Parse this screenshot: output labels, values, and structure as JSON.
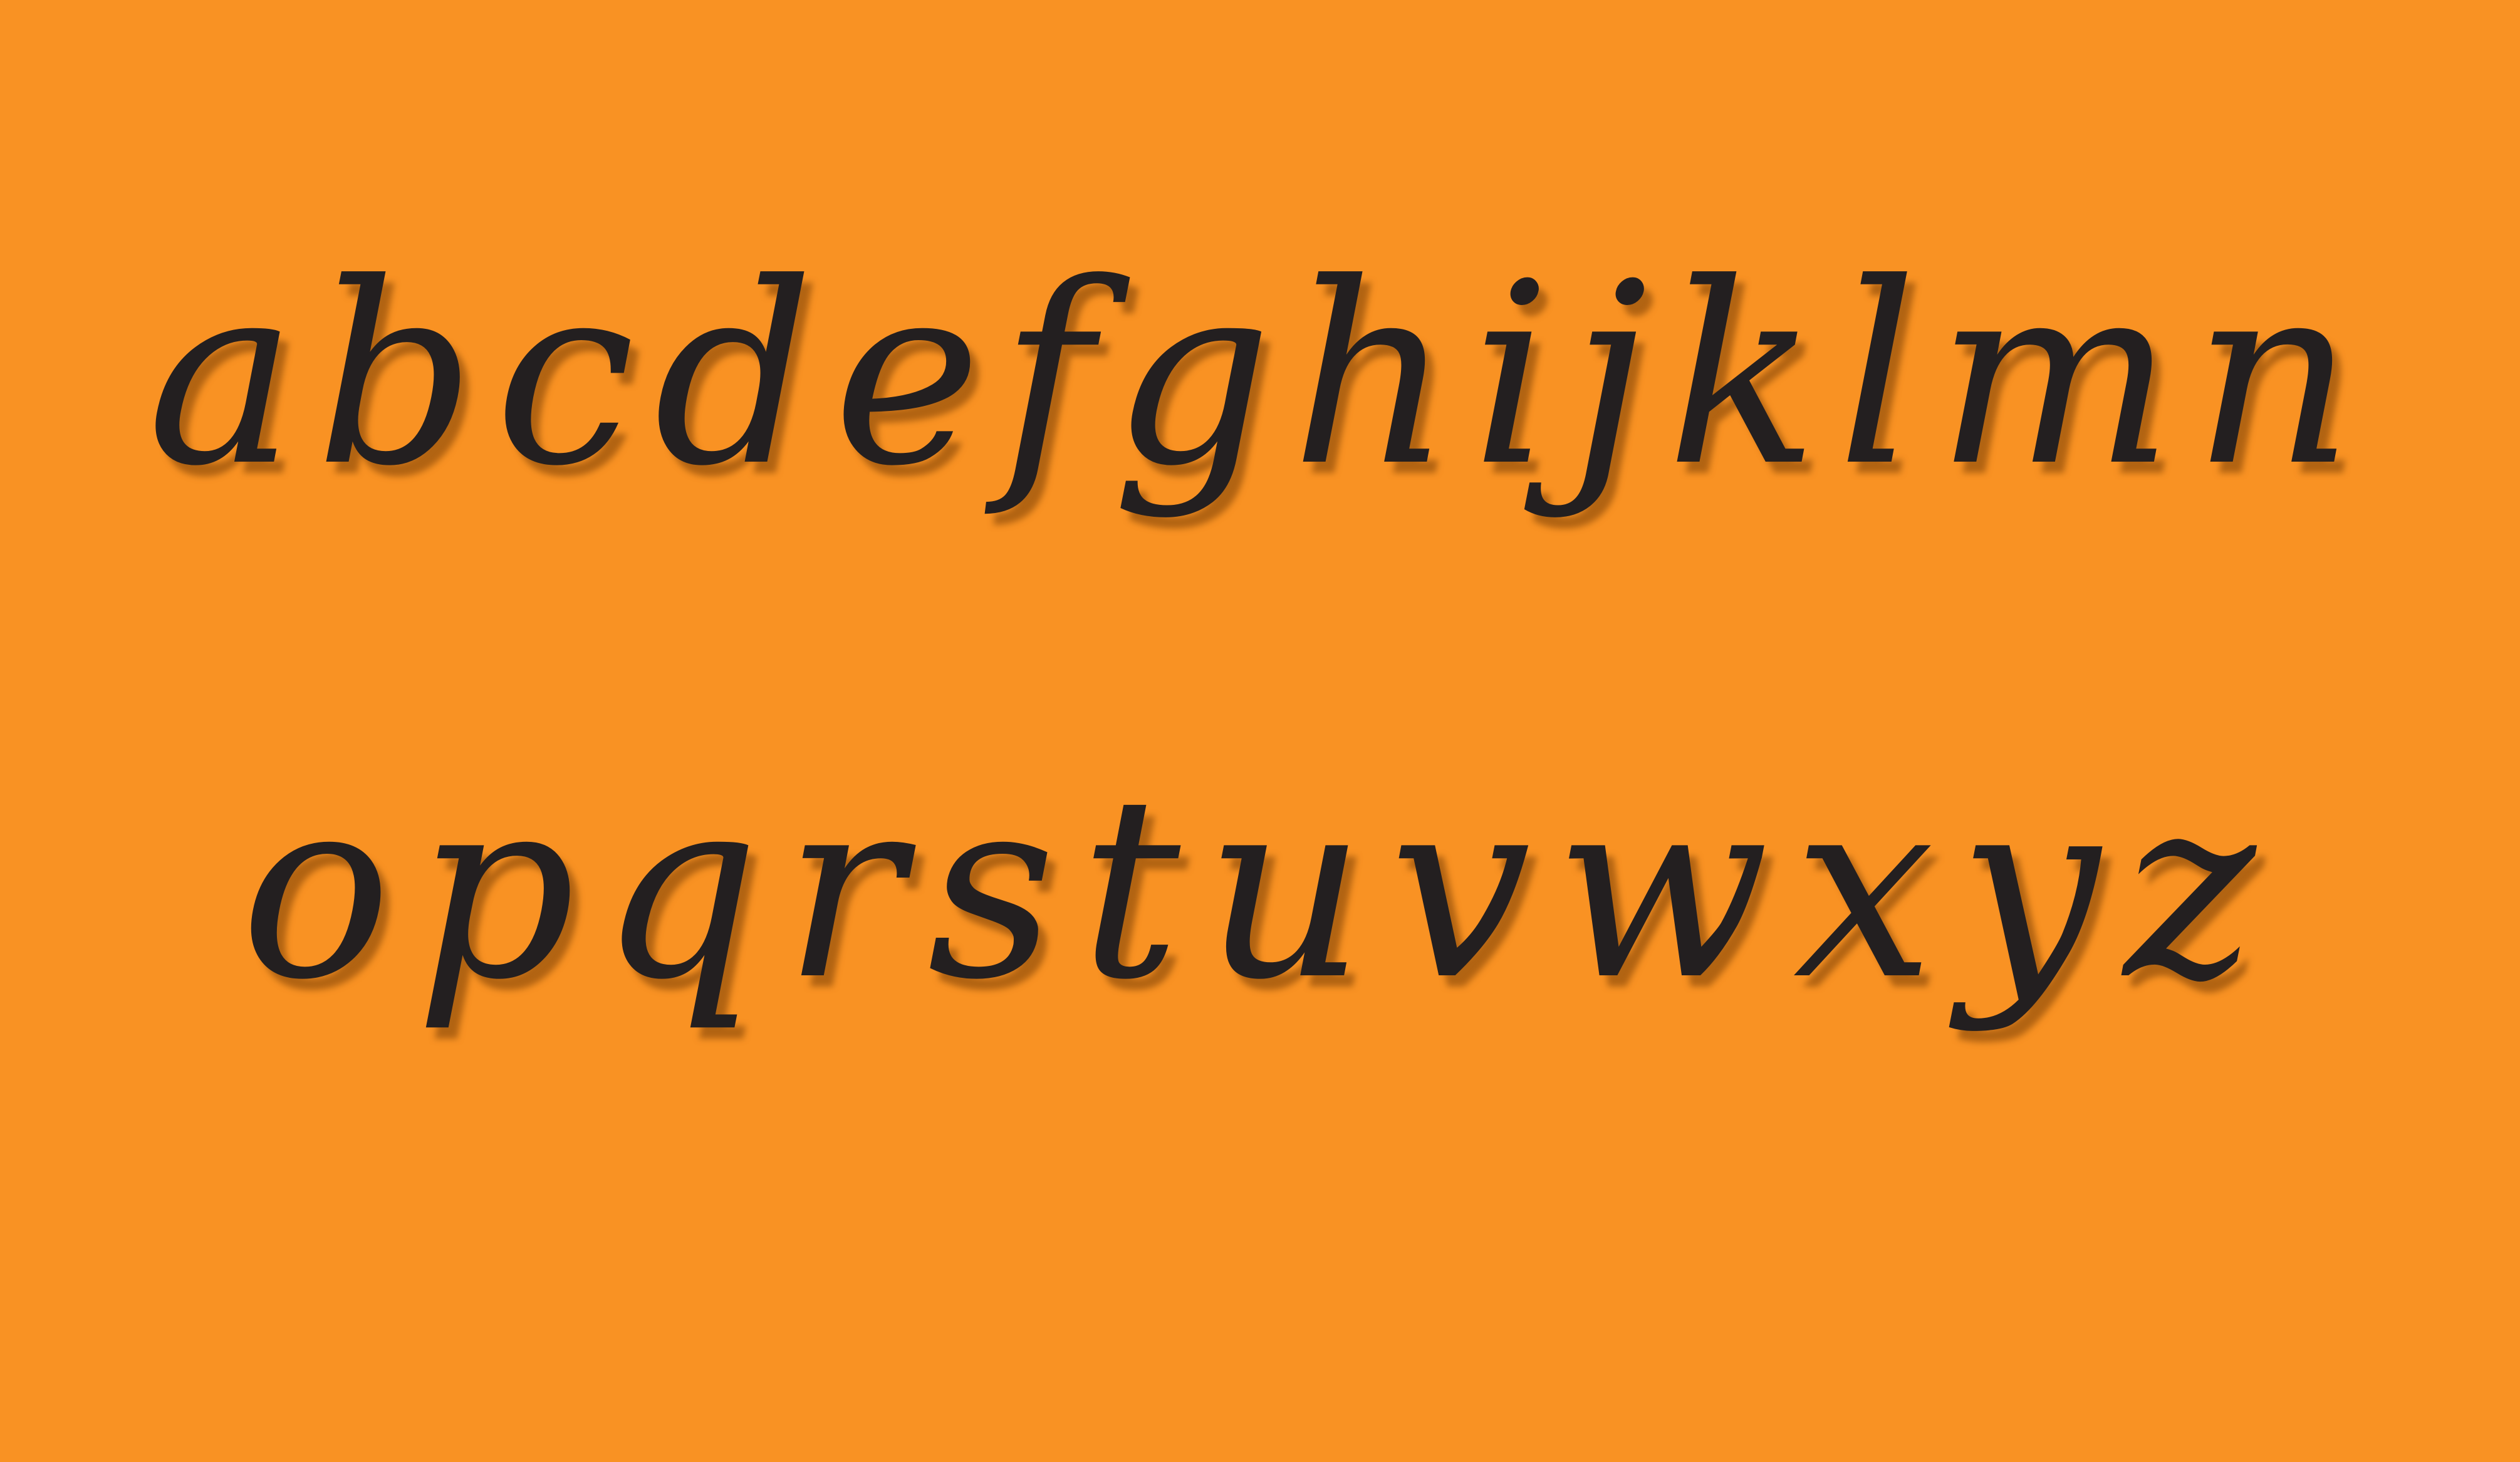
{
  "background_color": "#f99223",
  "text_color": "#231f20",
  "alphabet": {
    "line_one": "abcdefghijklmn",
    "line_two": "opqrstuvwxyz"
  }
}
